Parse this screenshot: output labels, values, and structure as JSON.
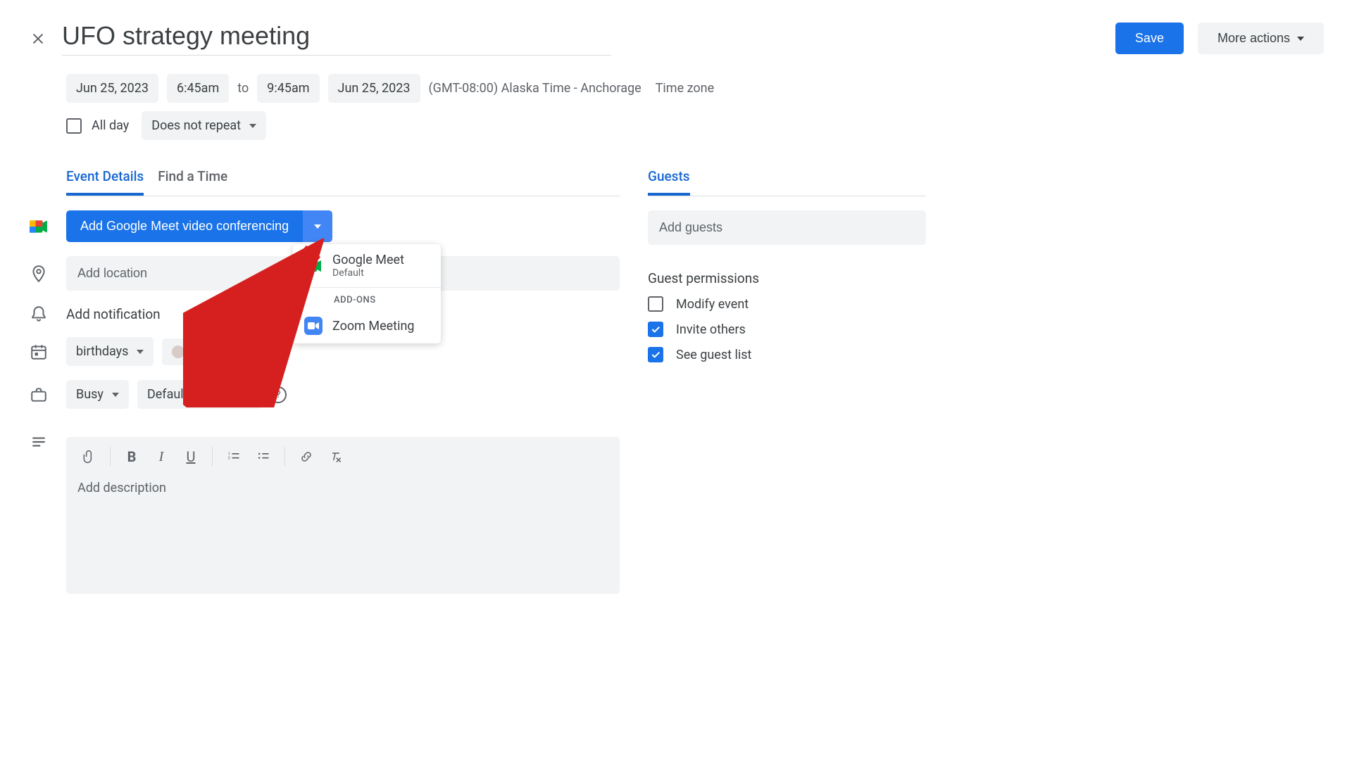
{
  "header": {
    "title": "UFO strategy meeting",
    "save": "Save",
    "more_actions": "More actions"
  },
  "datetime": {
    "start_date": "Jun 25, 2023",
    "start_time": "6:45am",
    "to": "to",
    "end_time": "9:45am",
    "end_date": "Jun 25, 2023",
    "timezone_text": "(GMT-08:00) Alaska Time - Anchorage",
    "timezone_link": "Time zone"
  },
  "allday": {
    "label": "All day",
    "repeat": "Does not repeat"
  },
  "tabs": {
    "event_details": "Event Details",
    "find_time": "Find a Time"
  },
  "meet": {
    "button": "Add Google Meet video conferencing"
  },
  "dropdown": {
    "gmeet": "Google Meet",
    "gmeet_sub": "Default",
    "addons_hdr": "ADD-ONS",
    "zoom": "Zoom Meeting"
  },
  "location": {
    "placeholder": "Add location"
  },
  "notification": {
    "label": "Add notification"
  },
  "calendar": {
    "name": "birthdays"
  },
  "busy": {
    "status": "Busy",
    "visibility": "Default visibility"
  },
  "description": {
    "placeholder": "Add description"
  },
  "guests": {
    "tab": "Guests",
    "add_placeholder": "Add guests",
    "perm_hdr": "Guest permissions",
    "modify": "Modify event",
    "invite": "Invite others",
    "see_list": "See guest list"
  }
}
